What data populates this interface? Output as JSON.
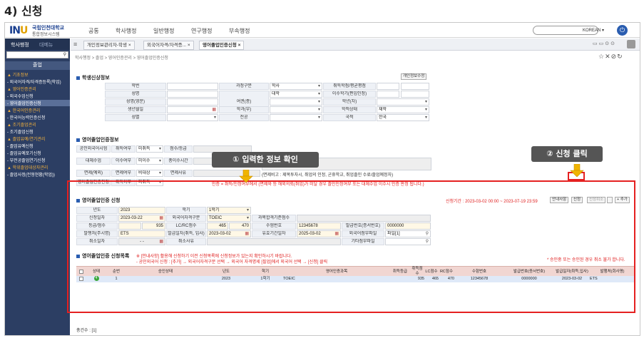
{
  "heading": "4) 신청",
  "topbar": {
    "logo_mark": "IN",
    "logo_u": "U",
    "logo_title": "국립인천대학교",
    "logo_sub": "통합정보시스템",
    "menus": [
      "공통",
      "학사행정",
      "일반행정",
      "연구행정",
      "부속행정"
    ],
    "language": "KOREAN",
    "power_icon": "⏻"
  },
  "sidebar": {
    "tabs": [
      "학사행정",
      "대메뉴"
    ],
    "header": "졸업",
    "items": [
      {
        "text": "▲ 기초정보",
        "type": "cat"
      },
      {
        "text": "- 외국어자격/자격증등록(학업)",
        "type": "item"
      },
      {
        "text": "▲ 영어인증관리",
        "type": "cat"
      },
      {
        "text": "- 외국수업신청",
        "type": "item"
      },
      {
        "text": "- 영어졸업인증신청",
        "type": "sel"
      },
      {
        "text": "▲ 한국어인증관리",
        "type": "cat"
      },
      {
        "text": "- 한국어능력인증신청",
        "type": "item"
      },
      {
        "text": "▲ 조기졸업관리",
        "type": "cat"
      },
      {
        "text": "- 조기졸업신청",
        "type": "item"
      },
      {
        "text": "▲ 졸업유예/연기관리",
        "type": "cat"
      },
      {
        "text": "- 졸업유예신청",
        "type": "item"
      },
      {
        "text": "- 졸업유예포기신청",
        "type": "item"
      },
      {
        "text": "- 부전공졸업연기신청",
        "type": "item"
      },
      {
        "text": "▲ 학위졸업대상자관리",
        "type": "cat"
      },
      {
        "text": "- 졸업사정(전형현황(학업))",
        "type": "item"
      }
    ]
  },
  "tabs": [
    {
      "label": "개인정보관리자-학생",
      "close": "×"
    },
    {
      "label": "외국어자격/자격증...",
      "close": "×"
    },
    {
      "label": "영어졸업인증신청",
      "close": "×"
    }
  ],
  "breadcrumb": "학사행정 > 졸업 > 영어인증관리 > 영어졸업인증신청",
  "student": {
    "title": "학생신상정보",
    "personal_btn": "개인정보수정",
    "labels": [
      "학번",
      "성명",
      "성명(영문)",
      "생년월일",
      "성별",
      "과정구분",
      "대학",
      "학과(부)",
      "전공",
      "취득학점/평균평점",
      "이수학기(편입인정)",
      "학년(차)",
      "학적상태",
      "국적",
      "여권(종)"
    ],
    "values": {
      "course": "학사",
      "college": "대학",
      "status": "재학",
      "nationality": "한국"
    }
  },
  "cert_info": {
    "title": "영어졸업인증정보",
    "rows": [
      {
        "label": "공인외국어시험",
        "sub": "취득여부",
        "value": "미취득",
        "sub2": "점수/등급"
      },
      {
        "label": "대체수업",
        "sub": "이수여부",
        "value": "미이수",
        "sub2": "총이수시간"
      },
      {
        "label": "면제(예외)",
        "sub": "면제여부",
        "value": "비대상",
        "sub2": "면제사유"
      },
      {
        "label": "영어졸업인증판정",
        "sub": "취득여부",
        "value": "미취득"
      }
    ],
    "exempt_note": "(면제비고 : 제목투자시, 취업의 인정, 군휴학교, 취업졸인 수료/졸업예정자)",
    "warning": "인증 = 취득/인정여부에서 (면제와 등 해외의뢰(취업)가 미달 경우 졸인인정여부 또는 대체수업 이수시 인증 판정 됩니다.)"
  },
  "apply": {
    "title": "영어졸업인증 신청",
    "period": "신청기간 : 2023-03-02 00:00 ~ 2023-07-19 23:59",
    "buttons": [
      "안내사항",
      "신청",
      "신청취소",
      "+ 추가"
    ],
    "form": {
      "year_label": "년도",
      "year": "2023",
      "term_label": "학기",
      "term": "1학기",
      "date_label": "신청일자",
      "date": "2023-03-22",
      "type_label": "외국어자격구분",
      "type": "TOEIC",
      "pass_label": "과목합격기준점수",
      "grade_label": "등급/점수",
      "score": "935",
      "lc_label": "LC/RC점수",
      "lc": "465",
      "rc": "470",
      "exam_label": "수험번호",
      "exam_no": "12345678",
      "issue_label": "발급번호(증서번호)",
      "issue_no": "0000000",
      "org_label": "발행처(주시명)",
      "org": "ETS",
      "issue_date_label": "발급일자(취득, 입사)",
      "issue_date": "2023-03-02",
      "valid_label": "유효기간일자",
      "valid_date": "2025-03-02",
      "attach_label": "외국어첨부파일",
      "attach": "파일[1]",
      "cancel_label": "취소일자",
      "cancel_date": "- -",
      "cancel_reason_label": "취소사유",
      "etc_label": "기타첨부파일"
    }
  },
  "list": {
    "title": "영어졸업인증 신청목록",
    "note1": "※ [안내사항] 활용해 신청하기 이전 신청목록에 신청정보가 있는지 확인하시기 바랍니다.",
    "note2": "- 공인외국어 신청 : [추가] → 외국어자격구분 선택 → 외국어 자격명세 [필업]에서 외국어 선택 → [신청] 클릭",
    "note_right": "* 승인중 또는 승인된 경우 취소 불가 합니다.",
    "headers": [
      "",
      "상태",
      "순번",
      "승인상태",
      "년도",
      "학기",
      "영어인증과목",
      "취득등급",
      "취득점수",
      "LC점수",
      "RC점수",
      "수험번호",
      "발급번호(증서번호)",
      "발급일자(취득,입사)",
      "발행처(회사명)"
    ],
    "rows": [
      {
        "status": "4",
        "no": "1",
        "approval": "",
        "year": "2023",
        "term": "1학기",
        "subject": "TOEIC",
        "grade": "",
        "score": "935",
        "lc": "465",
        "rc": "470",
        "exam": "12345678",
        "issue": "0000000",
        "date": "2023-03-02",
        "org": "ETS"
      }
    ],
    "total": "총건수 : [1]"
  },
  "callouts": {
    "step1": "① 입력한 정보 확인",
    "step2": "② 신청 클릭"
  },
  "colors": {
    "highlight": "#e52020",
    "arrow": "#f0b400",
    "callout_bg": "#555555",
    "nav": "#2c3e63"
  }
}
